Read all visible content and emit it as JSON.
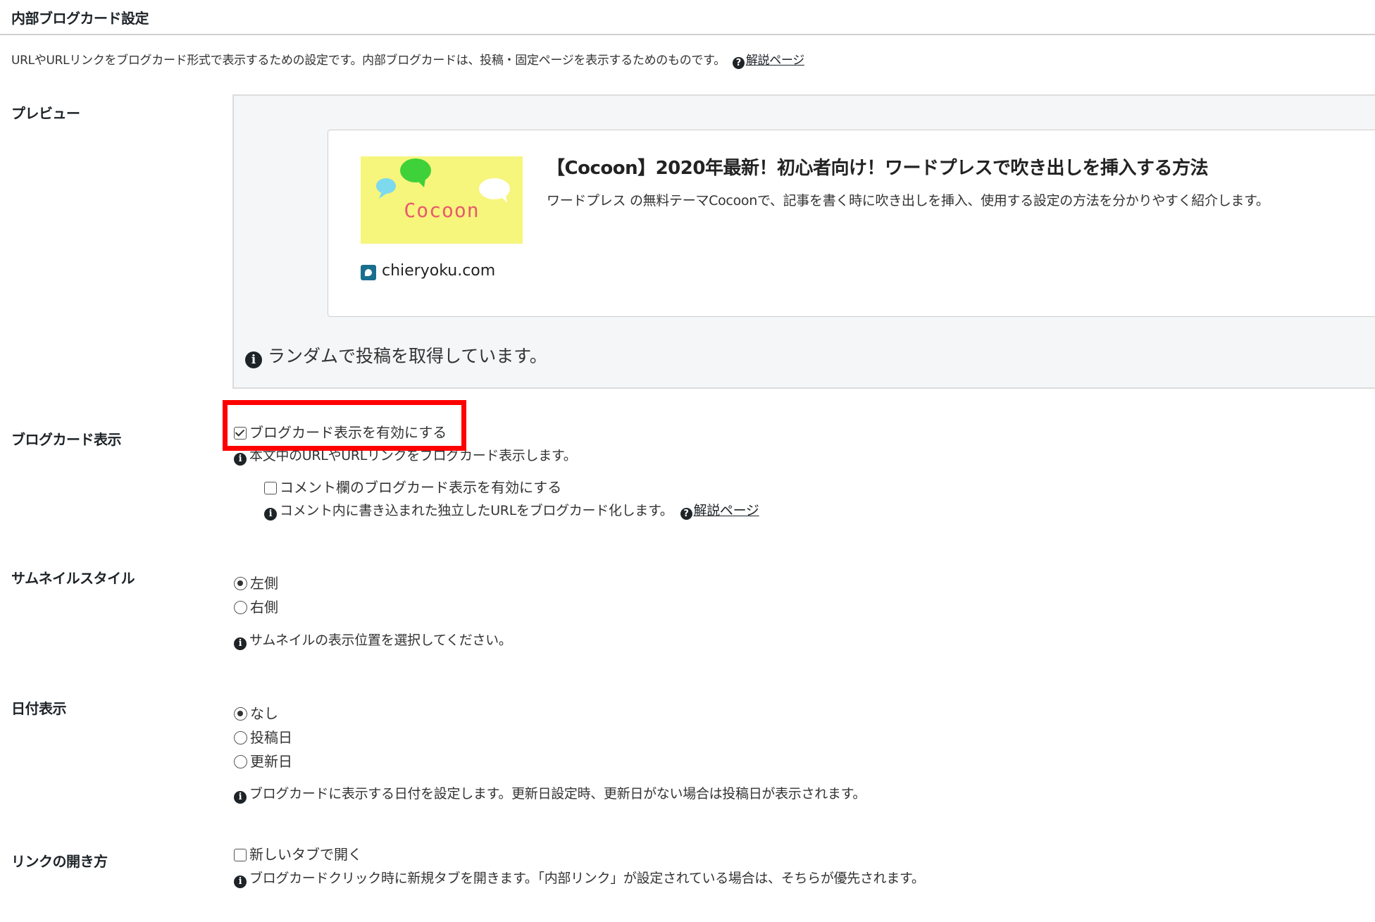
{
  "section_title": "内部ブログカード設定",
  "description": "URLやURLリンクをブログカード形式で表示するための設定です。内部ブログカードは、投稿・固定ページを表示するためのものです。",
  "help_link_label": "解説ページ",
  "preview": {
    "label": "プレビュー",
    "card_title": "【Cocoon】2020年最新！初心者向け！ワードプレスで吹き出しを挿入する方法",
    "card_snippet": "ワードプレス の無料テーマCocoonで、記事を書く時に吹き出しを挿入、使用する設定の方法を分かりやすく紹介します。",
    "thumbnail_text": "Cocoon",
    "site_name": "chieryoku.com",
    "random_note": "ランダムで投稿を取得しています。"
  },
  "blogcard_display": {
    "label": "ブログカード表示",
    "enable_label": "ブログカード表示を有効にする",
    "enable_checked": true,
    "enable_note": "本文中のURLやURLリンクをブログカード表示します。",
    "comment_label": "コメント欄のブログカード表示を有効にする",
    "comment_checked": false,
    "comment_note": "コメント内に書き込まれた独立したURLをブログカード化します。",
    "comment_help": "解説ページ"
  },
  "thumbnail_style": {
    "label": "サムネイルスタイル",
    "options": [
      "左側",
      "右側"
    ],
    "selected": "左側",
    "note": "サムネイルの表示位置を選択してください。"
  },
  "date_display": {
    "label": "日付表示",
    "options": [
      "なし",
      "投稿日",
      "更新日"
    ],
    "selected": "なし",
    "note": "ブログカードに表示する日付を設定します。更新日設定時、更新日がない場合は投稿日が表示されます。"
  },
  "link_open": {
    "label": "リンクの開き方",
    "newtab_label": "新しいタブで開く",
    "newtab_checked": false,
    "note": "ブログカードクリック時に新規タブを開きます。「内部リンク」が設定されている場合は、そちらが優先されます。"
  },
  "colors": {
    "highlight": "#ff0000",
    "thumbnail_bg": "#f6f57c",
    "thumbnail_text": "#e8596d",
    "preview_bg": "#f5f6f7"
  }
}
